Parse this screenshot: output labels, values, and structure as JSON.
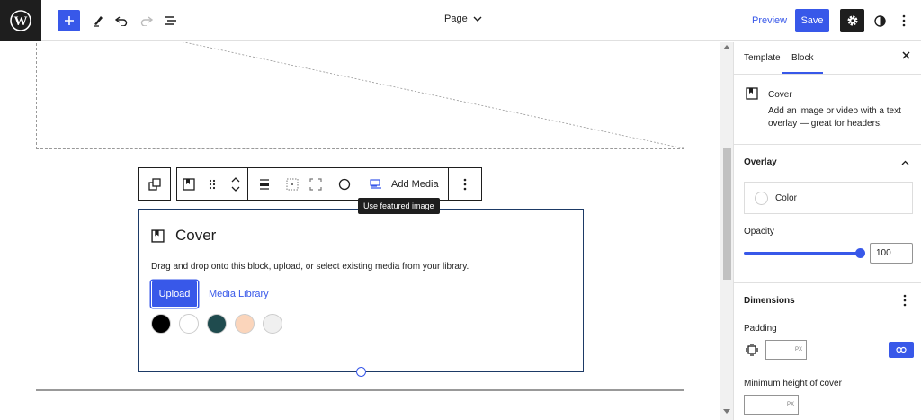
{
  "topbar": {
    "logo_icon": "wordpress-logo-icon",
    "add_icon": "plus-icon",
    "tools": [
      "pencil-icon",
      "undo-icon",
      "redo-icon",
      "list-view-icon"
    ],
    "document_title": "Page",
    "preview_label": "Preview",
    "save_label": "Save",
    "settings_icon": "gear-icon",
    "styles_icon": "half-circle-icon",
    "options_icon": "vertical-ellipsis-icon"
  },
  "block_toolbar": {
    "add_media_label": "Add Media",
    "tooltip": "Use featured image"
  },
  "cover": {
    "label": "Cover",
    "instructions": "Drag and drop onto this block, upload, or select existing media from your library.",
    "upload_label": "Upload",
    "media_library_label": "Media Library",
    "swatches": [
      "#000000",
      "#ffffff",
      "#1f4b4e",
      "#fbd5bb",
      "#f0f0f0"
    ]
  },
  "sidebar": {
    "tabs": [
      "Template",
      "Block"
    ],
    "active_tab": "Block",
    "block_name": "Cover",
    "block_description": "Add an image or video with a text overlay — great for headers.",
    "overlay": {
      "title": "Overlay",
      "color_label": "Color",
      "opacity_label": "Opacity",
      "opacity_value": "100"
    },
    "dimensions": {
      "title": "Dimensions",
      "padding_label": "Padding",
      "padding_unit": "PX",
      "min_height_label": "Minimum height of cover",
      "min_height_unit": "PX"
    }
  },
  "colors": {
    "accent": "#3858e9",
    "dark": "#1e1e1e"
  }
}
